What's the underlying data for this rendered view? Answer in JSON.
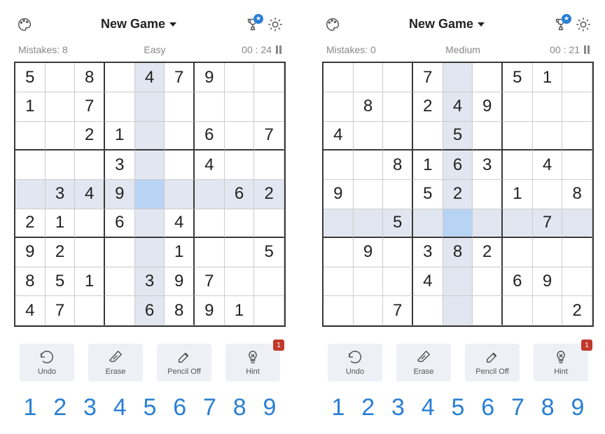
{
  "games": [
    {
      "new_game_label": "New Game",
      "mistakes_label": "Mistakes: 8",
      "difficulty": "Easy",
      "timer": "00 : 24",
      "selected": [
        4,
        4
      ],
      "board": [
        [
          "5",
          "",
          "8",
          "",
          "4",
          "7",
          "9",
          "",
          ""
        ],
        [
          "1",
          "",
          "7",
          "",
          "",
          "",
          "",
          "",
          ""
        ],
        [
          "",
          "",
          "2",
          "1",
          "",
          "",
          "6",
          "",
          "7"
        ],
        [
          "",
          "",
          "",
          "3",
          "",
          "",
          "4",
          "",
          ""
        ],
        [
          "",
          "3",
          "4",
          "9",
          "",
          "",
          "",
          "6",
          "2"
        ],
        [
          "2",
          "1",
          "",
          "6",
          "",
          "4",
          "",
          "",
          ""
        ],
        [
          "9",
          "2",
          "",
          "",
          "",
          "1",
          "",
          "",
          "5"
        ],
        [
          "8",
          "5",
          "1",
          "",
          "3",
          "9",
          "7",
          "",
          ""
        ],
        [
          "4",
          "7",
          "",
          "",
          "6",
          "8",
          "9",
          "1",
          ""
        ]
      ],
      "actions": {
        "undo": "Undo",
        "erase": "Erase",
        "pencil": "Pencil Off",
        "hint": "Hint",
        "hint_badge": "1"
      }
    },
    {
      "new_game_label": "New Game",
      "mistakes_label": "Mistakes: 0",
      "difficulty": "Medium",
      "timer": "00 : 21",
      "selected": [
        5,
        4
      ],
      "board": [
        [
          "",
          "",
          "",
          "7",
          "",
          "",
          "5",
          "1",
          ""
        ],
        [
          "",
          "8",
          "",
          "2",
          "4",
          "9",
          "",
          "",
          ""
        ],
        [
          "4",
          "",
          "",
          "",
          "5",
          "",
          "",
          "",
          ""
        ],
        [
          "",
          "",
          "8",
          "1",
          "6",
          "3",
          "",
          "4",
          ""
        ],
        [
          "9",
          "",
          "",
          "5",
          "2",
          "",
          "1",
          "",
          "8"
        ],
        [
          "",
          "",
          "5",
          "",
          "",
          "",
          "",
          "7",
          ""
        ],
        [
          "",
          "9",
          "",
          "3",
          "8",
          "2",
          "",
          "",
          ""
        ],
        [
          "",
          "",
          "",
          "4",
          "",
          "",
          "6",
          "9",
          ""
        ],
        [
          "",
          "",
          "7",
          "",
          "",
          "",
          "",
          "",
          "2"
        ]
      ],
      "actions": {
        "undo": "Undo",
        "erase": "Erase",
        "pencil": "Pencil Off",
        "hint": "Hint",
        "hint_badge": "1"
      }
    }
  ],
  "numpad": [
    "1",
    "2",
    "3",
    "4",
    "5",
    "6",
    "7",
    "8",
    "9"
  ]
}
